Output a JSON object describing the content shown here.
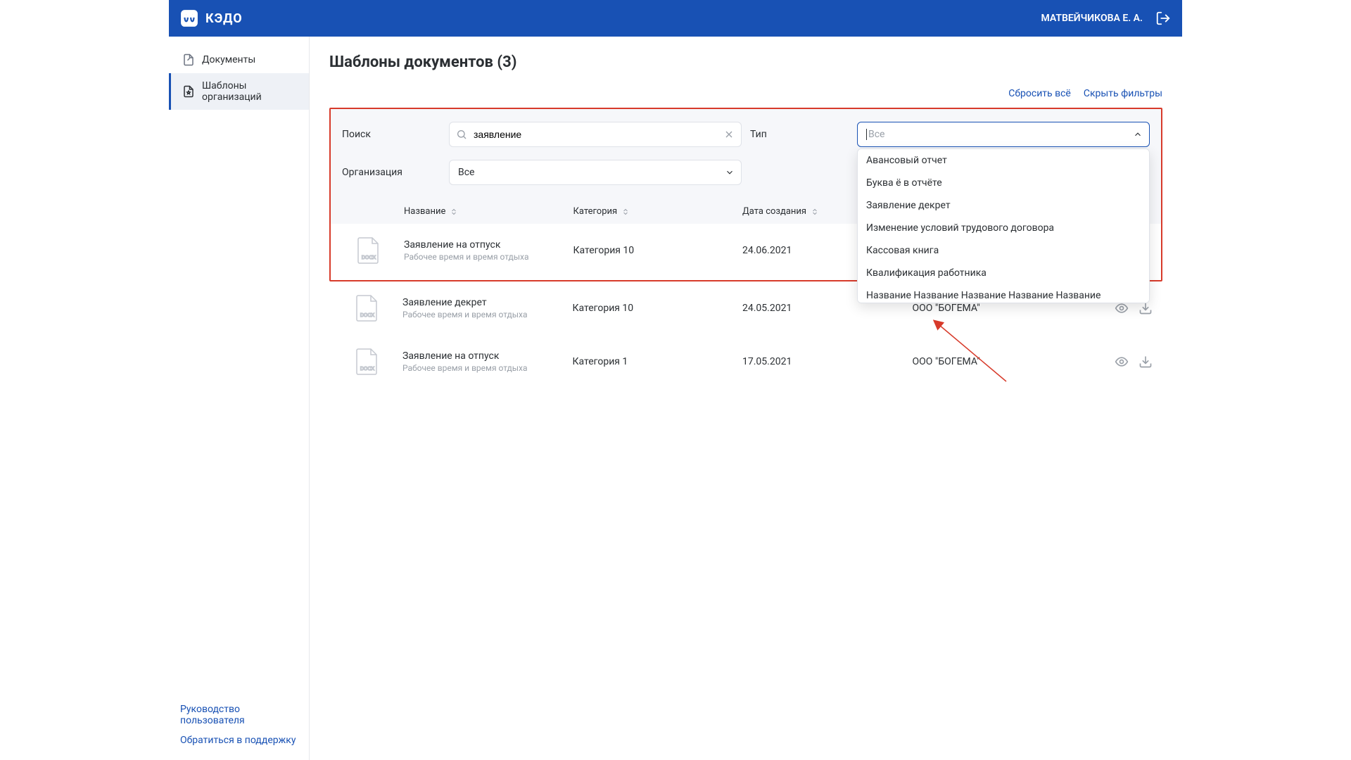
{
  "header": {
    "appName": "КЭДО",
    "userName": "МАТВЕЙЧИКОВА Е. А."
  },
  "sidebar": {
    "items": [
      {
        "label": "Документы"
      },
      {
        "label": "Шаблоны организаций"
      }
    ],
    "footer": {
      "guide": "Руководство пользователя",
      "support": "Обратиться в поддержку"
    }
  },
  "page": {
    "title": "Шаблоны документов (3)"
  },
  "filterActions": {
    "reset": "Сбросить всё",
    "hide": "Скрыть фильтры"
  },
  "filters": {
    "searchLabel": "Поиск",
    "searchValue": "заявление",
    "typeLabel": "Тип",
    "typePlaceholder": "Все",
    "orgLabel": "Организация",
    "orgValue": "Все",
    "typeOptions": [
      "Авансовый отчет",
      "Буква ё в отчёте",
      "Заявление декрет",
      "Изменение условий трудового договора",
      "Кассовая книга",
      "Квалификация работника",
      "Название Название Название Название Название Название"
    ]
  },
  "columns": {
    "name": "Название",
    "category": "Категория",
    "date": "Дата создания"
  },
  "rows": [
    {
      "name": "Заявление на отпуск",
      "sub": "Рабочее время и время отдыха",
      "category": "Категория 10",
      "date": "24.06.2021",
      "org": ""
    },
    {
      "name": "Заявление декрет",
      "sub": "Рабочее время и время отдыха",
      "category": "Категория 10",
      "date": "24.05.2021",
      "org": "ООО \"БОГЕМА\""
    },
    {
      "name": "Заявление на отпуск",
      "sub": "Рабочее время и время отдыха",
      "category": "Категория 1",
      "date": "17.05.2021",
      "org": "ООО \"БОГЕМА\""
    }
  ]
}
